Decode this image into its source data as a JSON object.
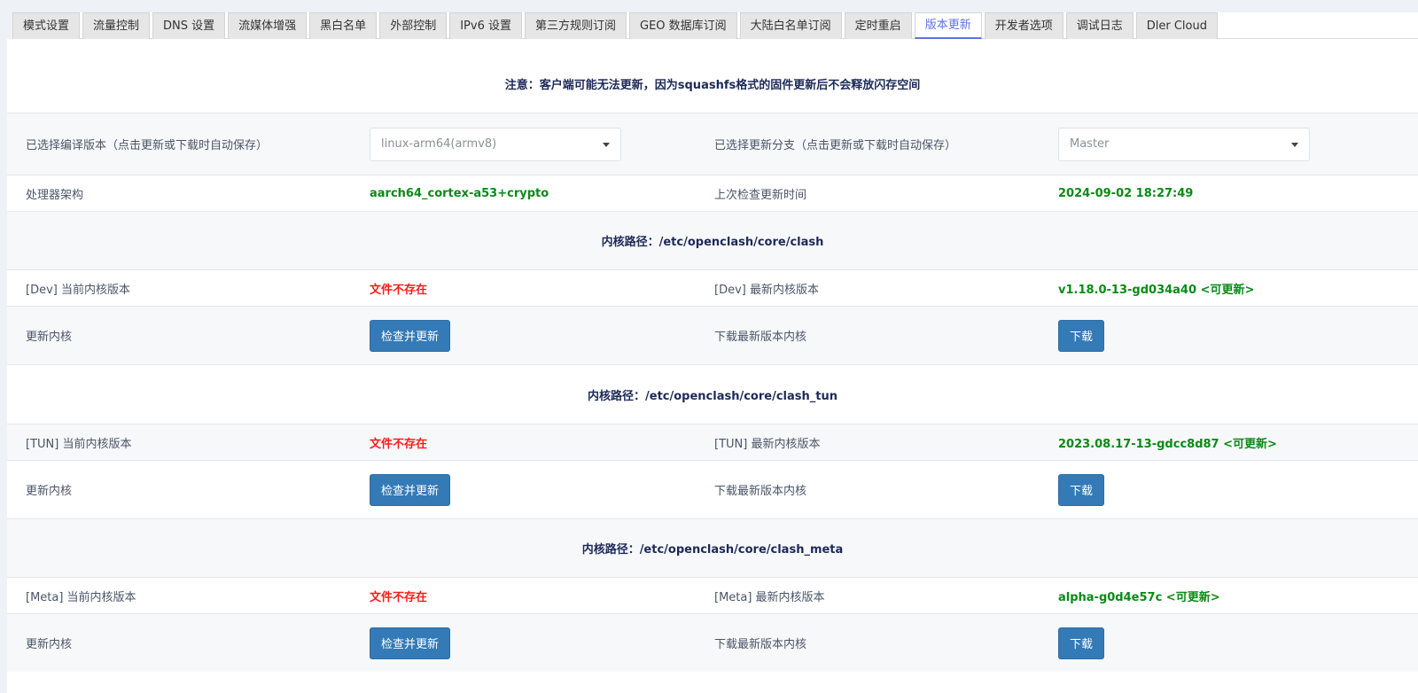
{
  "tabs": [
    {
      "label": "模式设置"
    },
    {
      "label": "流量控制"
    },
    {
      "label": "DNS 设置"
    },
    {
      "label": "流媒体增强"
    },
    {
      "label": "黑白名单"
    },
    {
      "label": "外部控制"
    },
    {
      "label": "IPv6 设置"
    },
    {
      "label": "第三方规则订阅"
    },
    {
      "label": "GEO 数据库订阅"
    },
    {
      "label": "大陆白名单订阅"
    },
    {
      "label": "定时重启"
    },
    {
      "label": "版本更新",
      "active": true
    },
    {
      "label": "开发者选项"
    },
    {
      "label": "调试日志"
    },
    {
      "label": "Dler Cloud"
    }
  ],
  "notice": "注意：客户端可能无法更新，因为squashfs格式的固件更新后不会释放闪存空间",
  "compile": {
    "label": "已选择编译版本（点击更新或下载时自动保存）",
    "value": "linux-arm64(armv8)",
    "branch_label": "已选择更新分支（点击更新或下载时自动保存）",
    "branch_value": "Master"
  },
  "arch": {
    "label": "处理器架构",
    "value": "aarch64_cortex-a53+crypto",
    "check_label": "上次检查更新时间",
    "check_value": "2024-09-02 18:27:49"
  },
  "cores": [
    {
      "path": "内核路径：/etc/openclash/core/clash",
      "current_label": "[Dev] 当前内核版本",
      "current_value": "文件不存在",
      "latest_label": "[Dev] 最新内核版本",
      "latest_value": "v1.18.0-13-gd034a40 <可更新>",
      "update_label": "更新内核",
      "update_button": "检查并更新",
      "download_label": "下载最新版本内核",
      "download_button": "下载"
    },
    {
      "path": "内核路径：/etc/openclash/core/clash_tun",
      "current_label": "[TUN] 当前内核版本",
      "current_value": "文件不存在",
      "latest_label": "[TUN] 最新内核版本",
      "latest_value": "2023.08.17-13-gdcc8d87 <可更新>",
      "update_label": "更新内核",
      "update_button": "检查并更新",
      "download_label": "下载最新版本内核",
      "download_button": "下载"
    },
    {
      "path": "内核路径：/etc/openclash/core/clash_meta",
      "current_label": "[Meta] 当前内核版本",
      "current_value": "文件不存在",
      "latest_label": "[Meta] 最新内核版本",
      "latest_value": "alpha-g0d4e57c <可更新>",
      "update_label": "更新内核",
      "update_button": "检查并更新",
      "download_label": "下载最新版本内核",
      "download_button": "下载"
    }
  ],
  "colors": {
    "accent": "#5e72e4",
    "button": "#337ab7",
    "ok_text": "#0a8a16",
    "error_text": "#ff1a1a"
  }
}
